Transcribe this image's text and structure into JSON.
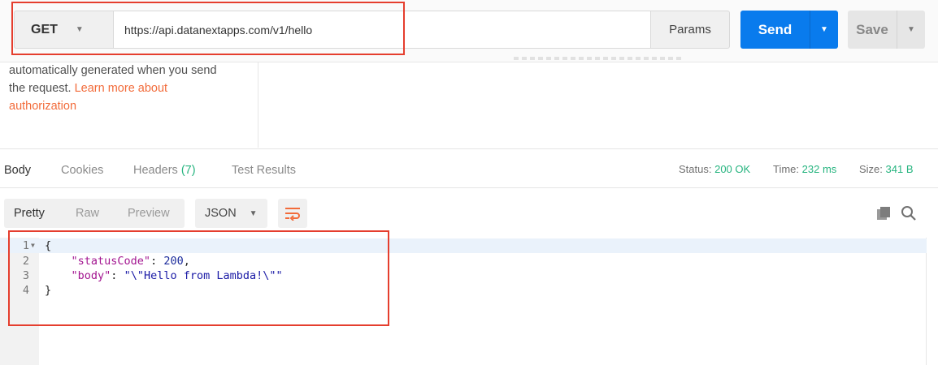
{
  "request": {
    "method": "GET",
    "url": "https://api.datanextapps.com/v1/hello",
    "params_label": "Params",
    "send_label": "Send",
    "save_label": "Save"
  },
  "auth_help": {
    "line1": "automatically generated when you send",
    "line2_text": "the request. ",
    "line2_link": "Learn more about",
    "line3_link": "authorization"
  },
  "response_tabs": [
    {
      "label": "Body"
    },
    {
      "label": "Cookies"
    },
    {
      "label": "Headers",
      "count": "(7)"
    },
    {
      "label": "Test Results"
    }
  ],
  "status": {
    "status_label": "Status:",
    "status_value": "200 OK",
    "time_label": "Time:",
    "time_value": "232 ms",
    "size_label": "Size:",
    "size_value": "341 B"
  },
  "view_modes": [
    "Pretty",
    "Raw",
    "Preview"
  ],
  "format": "JSON",
  "code": {
    "line_numbers": [
      "1",
      "2",
      "3",
      "4"
    ],
    "open_brace": "{",
    "close_brace": "}",
    "key1": "\"statusCode\"",
    "val1": "200",
    "key2": "\"body\"",
    "val2": "\"\\\"Hello from Lambda!\\\"\""
  },
  "colors": {
    "accent": "#097bed",
    "link": "#f26b3a",
    "success": "#26b47f",
    "highlight_box": "#e53e2e"
  },
  "icons": [
    "chevron-down-icon",
    "wrap-lines-icon",
    "copy-icon",
    "search-icon"
  ]
}
